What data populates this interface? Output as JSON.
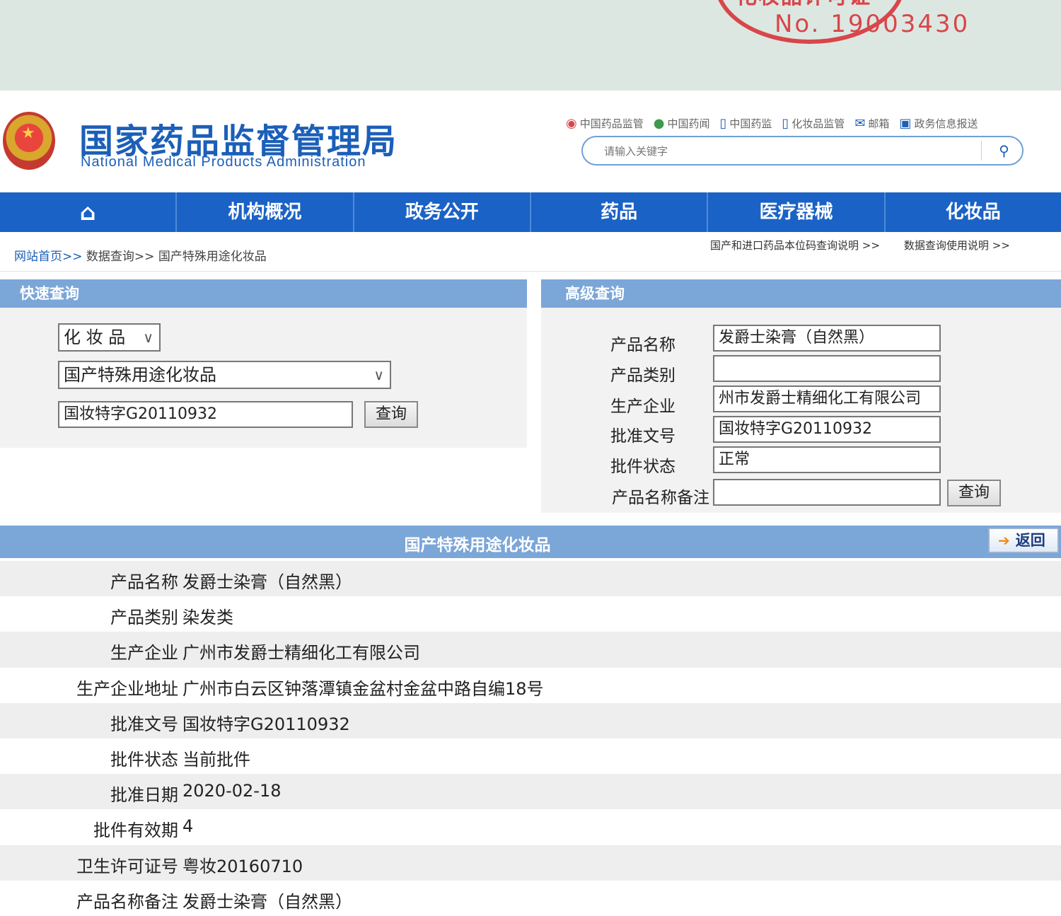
{
  "stamp": {
    "text": "化妆品许可证",
    "number": "No. 19003430"
  },
  "header": {
    "title": "国家药品监督管理局",
    "subtitle": "National Medical Products Administration"
  },
  "social": [
    {
      "icon": "weibo-icon",
      "label": "中国药品监管"
    },
    {
      "icon": "wechat-icon",
      "label": "中国药闻"
    },
    {
      "icon": "phone-icon",
      "label": "中国药监"
    },
    {
      "icon": "phone-icon",
      "label": "化妆品监管"
    },
    {
      "icon": "mail-icon",
      "label": "邮箱"
    },
    {
      "icon": "monitor-icon",
      "label": "政务信息报送"
    }
  ],
  "search": {
    "placeholder": "请输入关键字"
  },
  "nav": [
    "机构概况",
    "政务公开",
    "药品",
    "医疗器械",
    "化妆品"
  ],
  "breadcrumb": [
    "网站首页>>",
    "数据查询>>",
    "国产特殊用途化妆品"
  ],
  "help_links": [
    "国产和进口药品本位码查询说明 >>",
    "数据查询使用说明 >>"
  ],
  "quick": {
    "title": "快速查询",
    "category": "化 妆 品",
    "subcategory": "国产特殊用途化妆品",
    "keyword": "国妆特字G20110932",
    "button": "查询"
  },
  "advanced": {
    "title": "高级查询",
    "fields": [
      {
        "label": "产品名称",
        "value": "发爵士染膏（自然黑）"
      },
      {
        "label": "产品类别",
        "value": ""
      },
      {
        "label": "生产企业",
        "value": "州市发爵士精细化工有限公司"
      },
      {
        "label": "批准文号",
        "value": "国妆特字G20110932"
      },
      {
        "label": "批件状态",
        "value": "正常"
      },
      {
        "label": "产品名称备注",
        "value": ""
      }
    ],
    "button": "查询"
  },
  "result": {
    "title": "国产特殊用途化妆品",
    "back": "返回",
    "rows": [
      {
        "label": "产品名称",
        "value": "发爵士染膏（自然黑）"
      },
      {
        "label": "产品类别",
        "value": "染发类"
      },
      {
        "label": "生产企业",
        "value": "广州市发爵士精细化工有限公司"
      },
      {
        "label": "生产企业地址",
        "value": "广州市白云区钟落潭镇金盆村金盆中路自编18号"
      },
      {
        "label": "批准文号",
        "value": "国妆特字G20110932"
      },
      {
        "label": "批件状态",
        "value": "当前批件"
      },
      {
        "label": "批准日期",
        "value": "2020-02-18"
      },
      {
        "label": "批件有效期",
        "value": "4"
      },
      {
        "label": "卫生许可证号",
        "value": "粤妆20160710"
      },
      {
        "label": "产品名称备注",
        "value": "发爵士染膏（自然黑）"
      }
    ]
  }
}
